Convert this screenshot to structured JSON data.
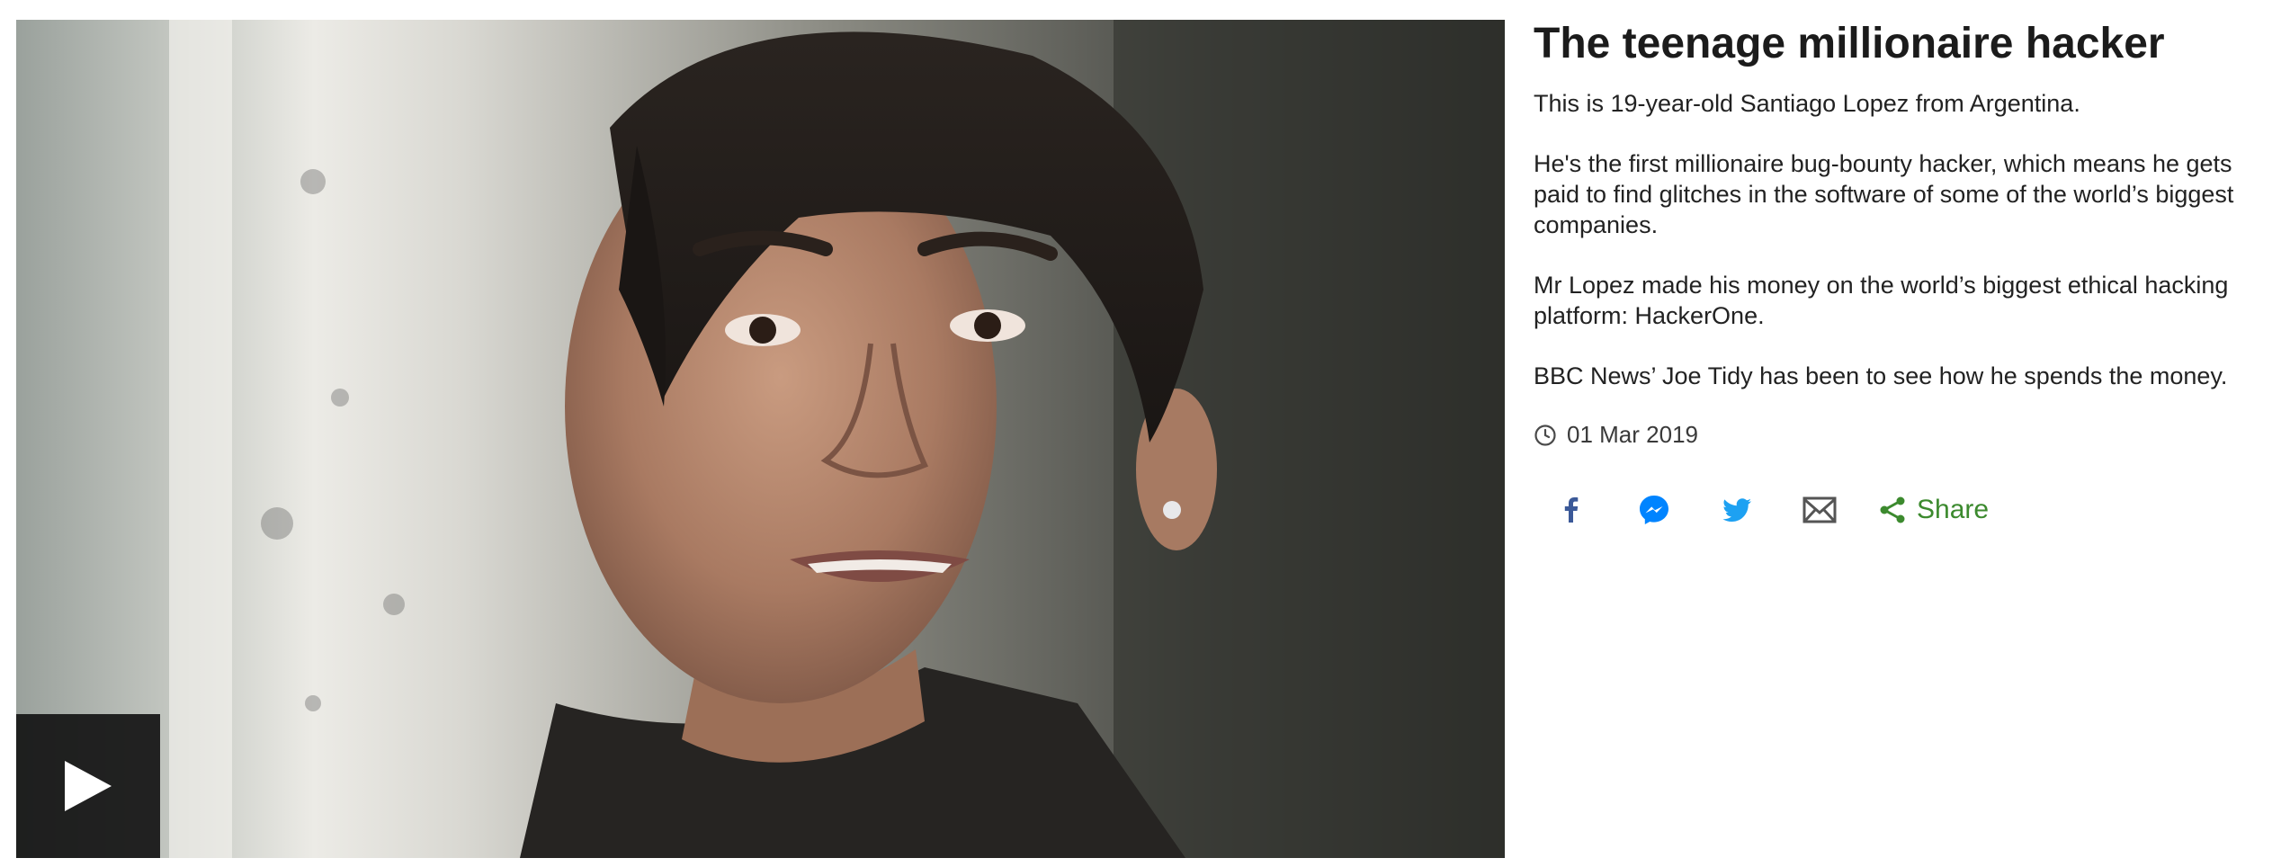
{
  "article": {
    "title": "The teenage millionaire hacker",
    "paragraphs": [
      "This is 19-year-old Santiago Lopez from Argentina.",
      "He's the first millionaire bug-bounty hacker, which means he gets paid to find glitches in the software of some of the world’s biggest companies.",
      "Mr Lopez made his money on the world’s biggest ethical hacking platform: HackerOne.",
      "BBC News’ Joe Tidy has been to see how he spends the money."
    ],
    "date": "01 Mar 2019"
  },
  "media": {
    "play_icon": "play-icon"
  },
  "share": {
    "label": "Share",
    "icons": [
      "facebook-icon",
      "messenger-icon",
      "twitter-icon",
      "email-icon",
      "share-icon"
    ]
  },
  "colors": {
    "facebook": "#3b5998",
    "messenger": "#0084ff",
    "twitter": "#1da1f2",
    "email": "#555555",
    "share_green": "#3c8a2e",
    "play_overlay": "#141414"
  }
}
